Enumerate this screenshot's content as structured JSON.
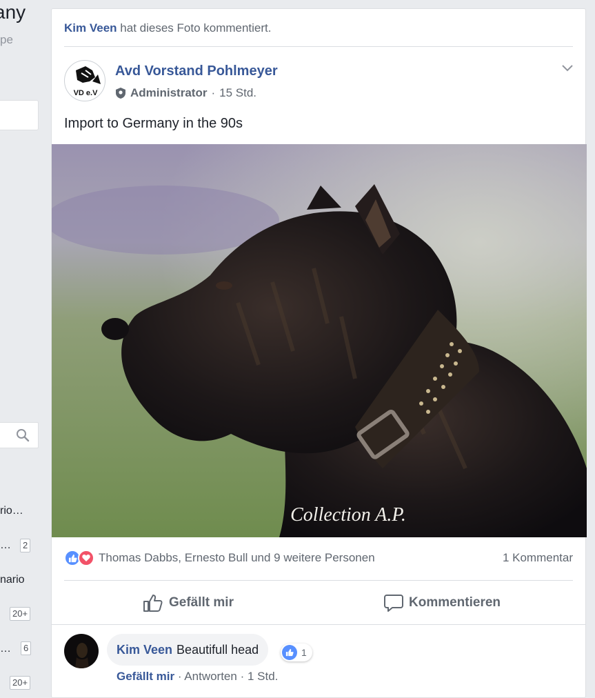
{
  "sidebar": {
    "title_fragment": "any",
    "subtitle_fragment": "pe",
    "items": [
      {
        "label": "rio…",
        "badge": ""
      },
      {
        "label": "…",
        "badge": "2"
      },
      {
        "label": "nario",
        "badge": ""
      },
      {
        "label": "",
        "badge": "20+"
      },
      {
        "label": "…",
        "badge": "6"
      },
      {
        "label": "",
        "badge": "20+"
      }
    ]
  },
  "post": {
    "story_actor": "Kim Veen",
    "story_text": "hat dieses Foto kommentiert.",
    "author": "Avd Vorstand Pohlmeyer",
    "role": "Administrator",
    "meta_sep": "·",
    "time": "15 Std.",
    "text": "Import to Germany in the 90s",
    "avatar_logo_text": "VD e.V",
    "photo_watermark": "Collection A.P.",
    "reactions_text": "Thomas Dabbs, Ernesto Bull und 9 weitere Personen",
    "comment_count": "1 Kommentar",
    "like_label": "Gefällt mir",
    "comment_label": "Kommentieren"
  },
  "comment": {
    "author": "Kim Veen",
    "text": "Beautifull head",
    "reaction_count": "1",
    "like_label": "Gefällt mir",
    "reply_label": "Antworten",
    "time": "1 Std.",
    "sep": "·"
  },
  "colors": {
    "link_blue": "#385898",
    "like_blue": "#5890ff",
    "love_red": "#f25268",
    "page_bg": "#e9ebee"
  },
  "icons": [
    "search-icon",
    "shield-icon",
    "chevron-down-icon",
    "like-reaction-icon",
    "love-reaction-icon",
    "thumbs-up-icon",
    "comment-icon"
  ]
}
